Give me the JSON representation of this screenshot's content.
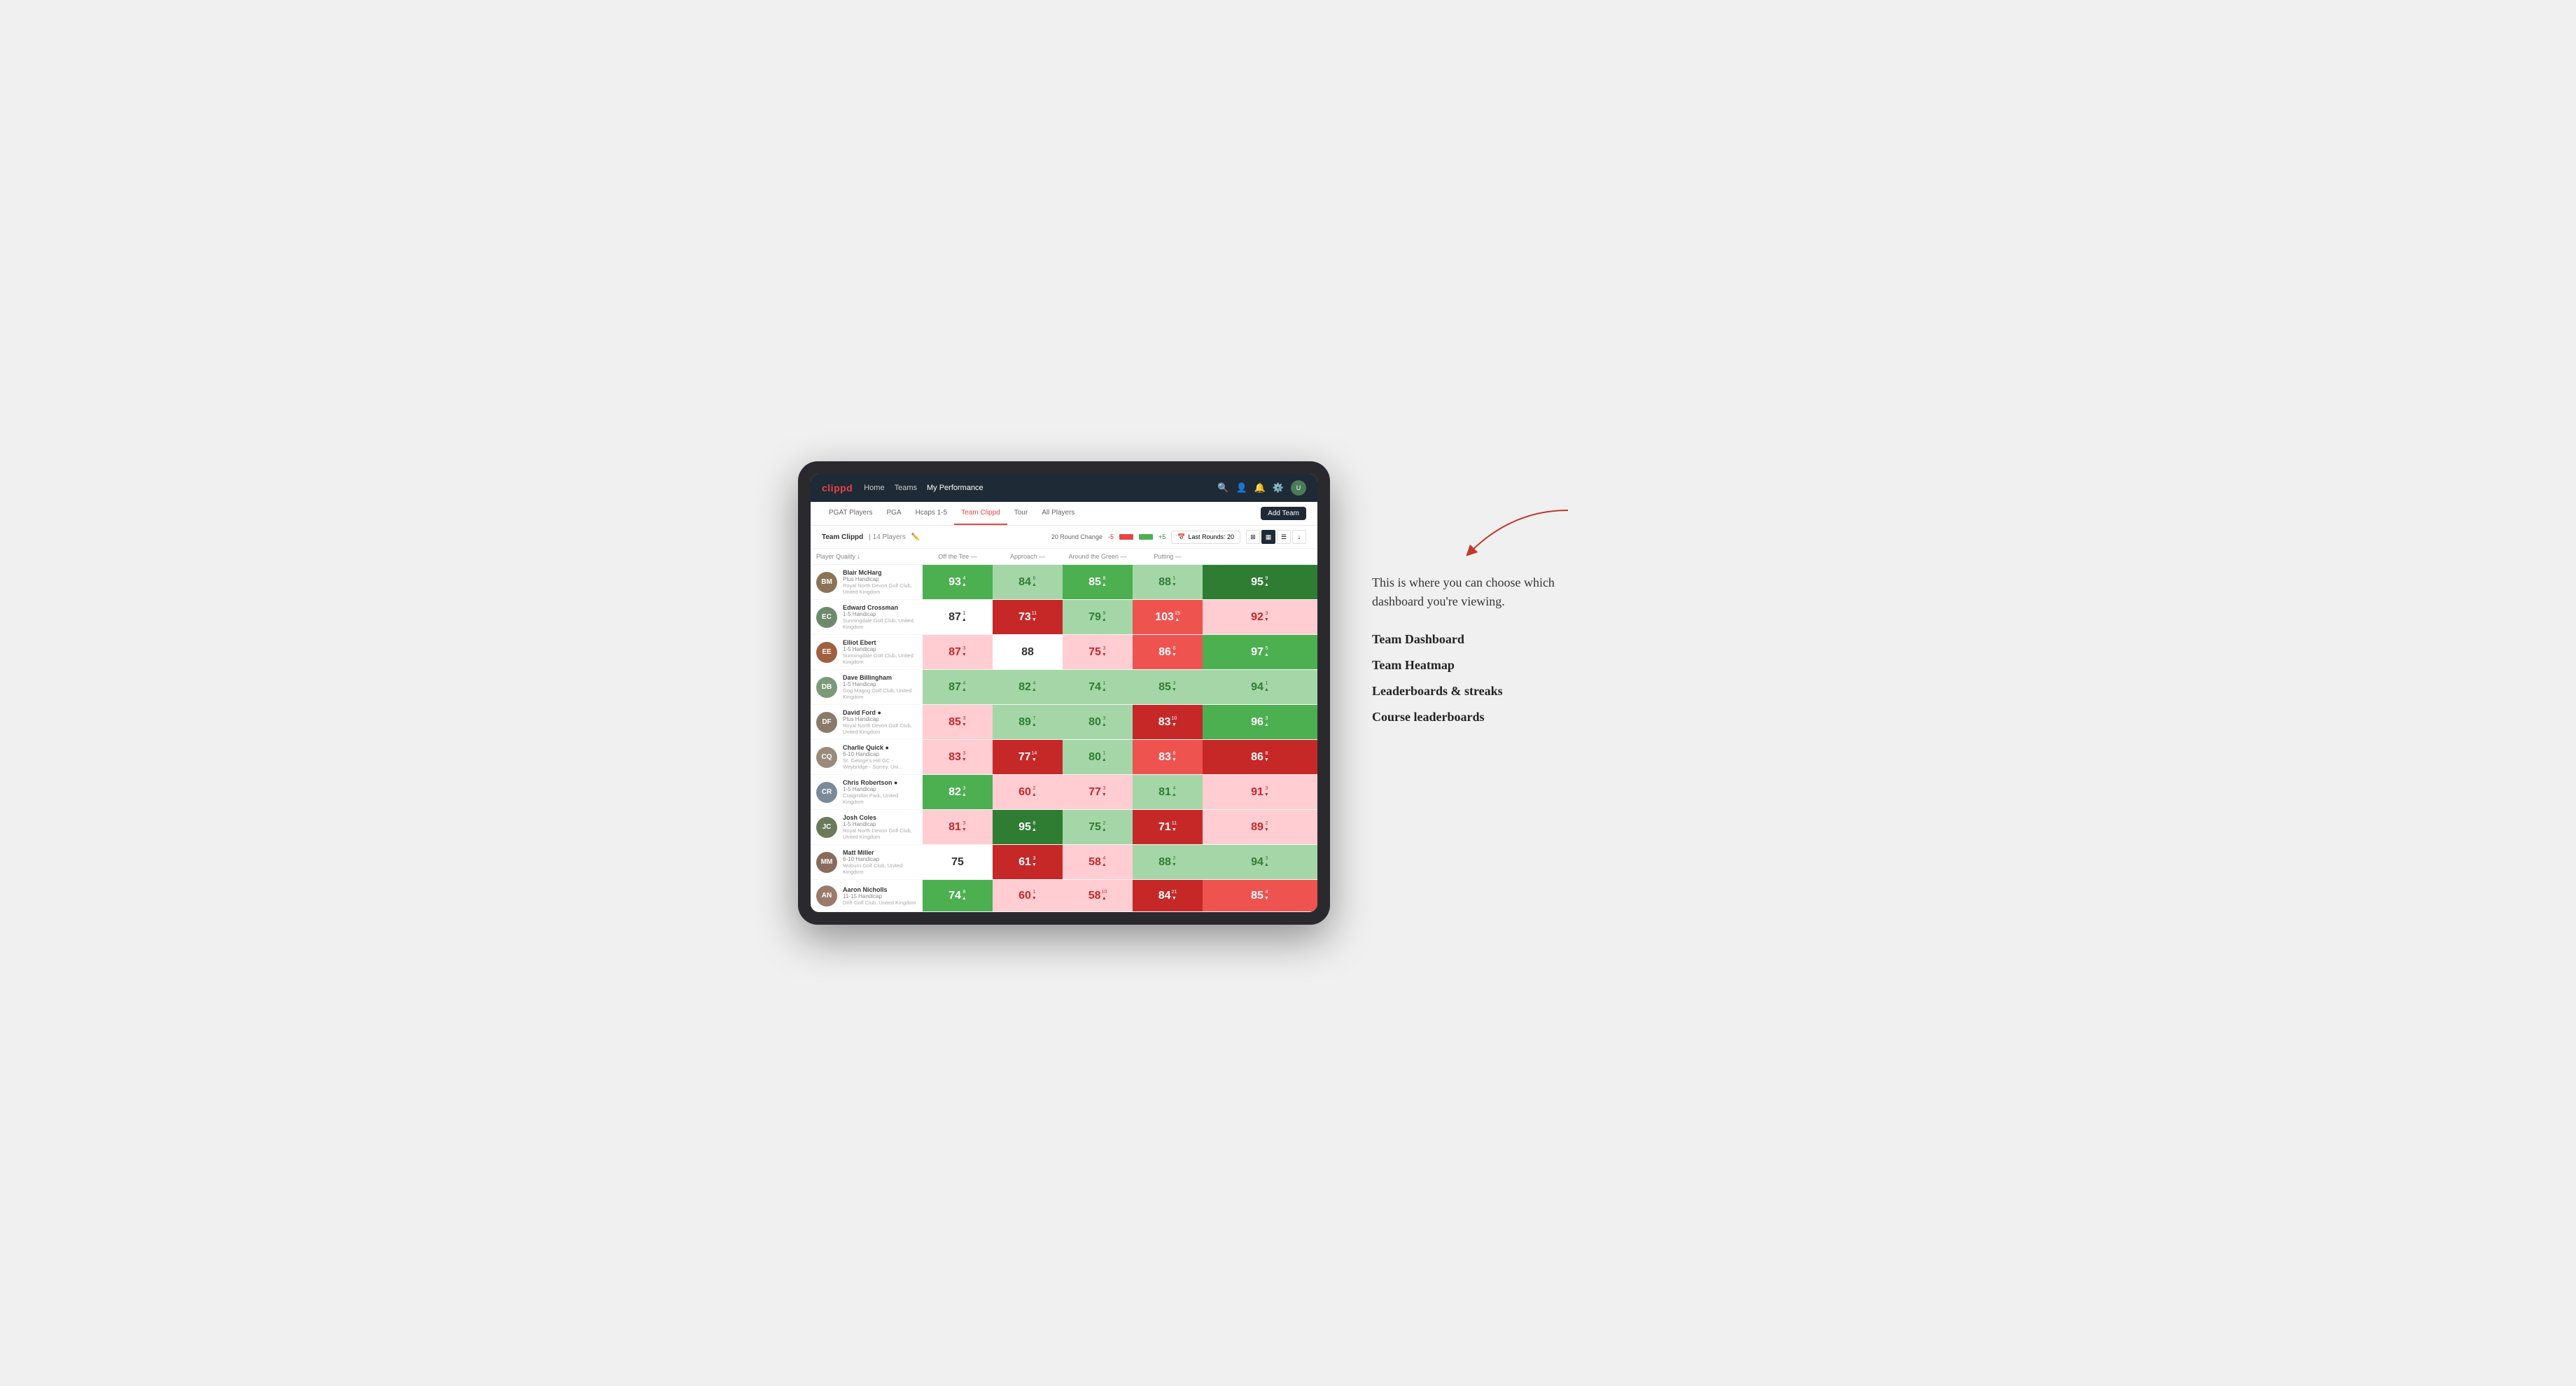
{
  "annotation": {
    "intro_text": "This is where you can choose which dashboard you're viewing.",
    "items": [
      "Team Dashboard",
      "Team Heatmap",
      "Leaderboards & streaks",
      "Course leaderboards"
    ]
  },
  "nav": {
    "logo": "clippd",
    "links": [
      "Home",
      "Teams",
      "My Performance"
    ],
    "active_link": "My Performance"
  },
  "sub_nav": {
    "links": [
      "PGAT Players",
      "PGA",
      "Hcaps 1-5",
      "Team Clippd",
      "Tour",
      "All Players"
    ],
    "active_link": "Team Clippd",
    "add_team_label": "Add Team"
  },
  "team_header": {
    "name": "Team Clippd",
    "separator": "|",
    "count": "14 Players",
    "round_change_label": "20 Round Change",
    "minus5": "-5",
    "plus5": "+5",
    "last_rounds_label": "Last Rounds:",
    "last_rounds_value": "20"
  },
  "col_headers": {
    "player": "Player Quality ↓",
    "off_tee": "Off the Tee —",
    "approach": "Approach —",
    "around_green": "Around the Green —",
    "putting": "Putting —"
  },
  "players": [
    {
      "name": "Blair McHarg",
      "handicap": "Plus Handicap",
      "club": "Royal North Devon Golf Club, United Kingdom",
      "initials": "BM",
      "avatar_color": "#8B7355",
      "quality": {
        "value": 93,
        "change": "+4",
        "dir": "up",
        "bg": "bg-green-mid"
      },
      "off_tee": {
        "value": 84,
        "change": "+6",
        "dir": "up",
        "bg": "bg-green-light"
      },
      "approach": {
        "value": 85,
        "change": "+8",
        "dir": "up",
        "bg": "bg-green-mid"
      },
      "around_green": {
        "value": 88,
        "change": "-1",
        "dir": "down",
        "bg": "bg-green-light"
      },
      "putting": {
        "value": 95,
        "change": "+9",
        "dir": "up",
        "bg": "bg-green-strong"
      }
    },
    {
      "name": "Edward Crossman",
      "handicap": "1-5 Handicap",
      "club": "Sunningdale Golf Club, United Kingdom",
      "initials": "EC",
      "avatar_color": "#6d8a6d",
      "quality": {
        "value": 87,
        "change": "+1",
        "dir": "up",
        "bg": "bg-white"
      },
      "off_tee": {
        "value": 73,
        "change": "-11",
        "dir": "down",
        "bg": "bg-red-strong"
      },
      "approach": {
        "value": 79,
        "change": "+9",
        "dir": "up",
        "bg": "bg-green-light"
      },
      "around_green": {
        "value": 103,
        "change": "+15",
        "dir": "up",
        "bg": "bg-red-mid"
      },
      "putting": {
        "value": 92,
        "change": "-3",
        "dir": "down",
        "bg": "bg-red-light"
      }
    },
    {
      "name": "Elliot Ebert",
      "handicap": "1-5 Handicap",
      "club": "Sunningdale Golf Club, United Kingdom",
      "initials": "EE",
      "avatar_color": "#a06040",
      "quality": {
        "value": 87,
        "change": "-3",
        "dir": "down",
        "bg": "bg-red-light"
      },
      "off_tee": {
        "value": 88,
        "change": "",
        "dir": "",
        "bg": "bg-white"
      },
      "approach": {
        "value": 75,
        "change": "-3",
        "dir": "down",
        "bg": "bg-red-light"
      },
      "around_green": {
        "value": 86,
        "change": "-6",
        "dir": "down",
        "bg": "bg-red-mid"
      },
      "putting": {
        "value": 97,
        "change": "+5",
        "dir": "up",
        "bg": "bg-green-mid"
      }
    },
    {
      "name": "Dave Billingham",
      "handicap": "1-5 Handicap",
      "club": "Gog Magog Golf Club, United Kingdom",
      "initials": "DB",
      "avatar_color": "#7a9a7a",
      "quality": {
        "value": 87,
        "change": "+4",
        "dir": "up",
        "bg": "bg-green-light"
      },
      "off_tee": {
        "value": 82,
        "change": "+4",
        "dir": "up",
        "bg": "bg-green-light"
      },
      "approach": {
        "value": 74,
        "change": "+1",
        "dir": "up",
        "bg": "bg-green-light"
      },
      "around_green": {
        "value": 85,
        "change": "-3",
        "dir": "down",
        "bg": "bg-green-light"
      },
      "putting": {
        "value": 94,
        "change": "+1",
        "dir": "up",
        "bg": "bg-green-light"
      }
    },
    {
      "name": "David Ford",
      "handicap": "Plus Handicap",
      "club": "Royal North Devon Golf Club, United Kingdom",
      "initials": "DF",
      "verified": true,
      "avatar_color": "#8a7a6a",
      "quality": {
        "value": 85,
        "change": "-3",
        "dir": "down",
        "bg": "bg-red-light"
      },
      "off_tee": {
        "value": 89,
        "change": "+7",
        "dir": "up",
        "bg": "bg-green-light"
      },
      "approach": {
        "value": 80,
        "change": "+3",
        "dir": "up",
        "bg": "bg-green-light"
      },
      "around_green": {
        "value": 83,
        "change": "-10",
        "dir": "down",
        "bg": "bg-red-strong"
      },
      "putting": {
        "value": 96,
        "change": "+3",
        "dir": "up",
        "bg": "bg-green-mid"
      }
    },
    {
      "name": "Charlie Quick",
      "handicap": "6-10 Handicap",
      "club": "St. George's Hill GC - Weybridge - Surrey, Uni...",
      "initials": "CQ",
      "verified": true,
      "avatar_color": "#9a8a7a",
      "quality": {
        "value": 83,
        "change": "-3",
        "dir": "down",
        "bg": "bg-red-light"
      },
      "off_tee": {
        "value": 77,
        "change": "-14",
        "dir": "down",
        "bg": "bg-red-strong"
      },
      "approach": {
        "value": 80,
        "change": "+1",
        "dir": "up",
        "bg": "bg-green-light"
      },
      "around_green": {
        "value": 83,
        "change": "-6",
        "dir": "down",
        "bg": "bg-red-mid"
      },
      "putting": {
        "value": 86,
        "change": "-8",
        "dir": "down",
        "bg": "bg-red-strong"
      }
    },
    {
      "name": "Chris Robertson",
      "handicap": "1-5 Handicap",
      "club": "Craigmillar Park, United Kingdom",
      "initials": "CR",
      "verified": true,
      "avatar_color": "#7a8a9a",
      "quality": {
        "value": 82,
        "change": "+3",
        "dir": "up",
        "bg": "bg-green-mid"
      },
      "off_tee": {
        "value": 60,
        "change": "+2",
        "dir": "up",
        "bg": "bg-red-light"
      },
      "approach": {
        "value": 77,
        "change": "-3",
        "dir": "down",
        "bg": "bg-red-light"
      },
      "around_green": {
        "value": 81,
        "change": "+4",
        "dir": "up",
        "bg": "bg-green-light"
      },
      "putting": {
        "value": 91,
        "change": "-3",
        "dir": "down",
        "bg": "bg-red-light"
      }
    },
    {
      "name": "Josh Coles",
      "handicap": "1-5 Handicap",
      "club": "Royal North Devon Golf Club, United Kingdom",
      "initials": "JC",
      "avatar_color": "#6a7a5a",
      "quality": {
        "value": 81,
        "change": "-3",
        "dir": "down",
        "bg": "bg-red-light"
      },
      "off_tee": {
        "value": 95,
        "change": "+8",
        "dir": "up",
        "bg": "bg-green-strong"
      },
      "approach": {
        "value": 75,
        "change": "+2",
        "dir": "up",
        "bg": "bg-green-light"
      },
      "around_green": {
        "value": 71,
        "change": "-11",
        "dir": "down",
        "bg": "bg-red-strong"
      },
      "putting": {
        "value": 89,
        "change": "-2",
        "dir": "down",
        "bg": "bg-red-light"
      }
    },
    {
      "name": "Matt Miller",
      "handicap": "6-10 Handicap",
      "club": "Woburn Golf Club, United Kingdom",
      "initials": "MM",
      "avatar_color": "#8a6a5a",
      "quality": {
        "value": 75,
        "change": "",
        "dir": "",
        "bg": "bg-white"
      },
      "off_tee": {
        "value": 61,
        "change": "-3",
        "dir": "down",
        "bg": "bg-red-strong"
      },
      "approach": {
        "value": 58,
        "change": "+4",
        "dir": "up",
        "bg": "bg-red-light"
      },
      "around_green": {
        "value": 88,
        "change": "-2",
        "dir": "down",
        "bg": "bg-green-light"
      },
      "putting": {
        "value": 94,
        "change": "+3",
        "dir": "up",
        "bg": "bg-green-light"
      }
    },
    {
      "name": "Aaron Nicholls",
      "handicap": "11-15 Handicap",
      "club": "Drift Golf Club, United Kingdom",
      "initials": "AN",
      "avatar_color": "#9a7a6a",
      "quality": {
        "value": 74,
        "change": "+8",
        "dir": "up",
        "bg": "bg-green-mid"
      },
      "off_tee": {
        "value": 60,
        "change": "-1",
        "dir": "down",
        "bg": "bg-red-light"
      },
      "approach": {
        "value": 58,
        "change": "+10",
        "dir": "up",
        "bg": "bg-red-light"
      },
      "around_green": {
        "value": 84,
        "change": "-21",
        "dir": "down",
        "bg": "bg-red-strong"
      },
      "putting": {
        "value": 85,
        "change": "-4",
        "dir": "down",
        "bg": "bg-red-mid"
      }
    }
  ]
}
